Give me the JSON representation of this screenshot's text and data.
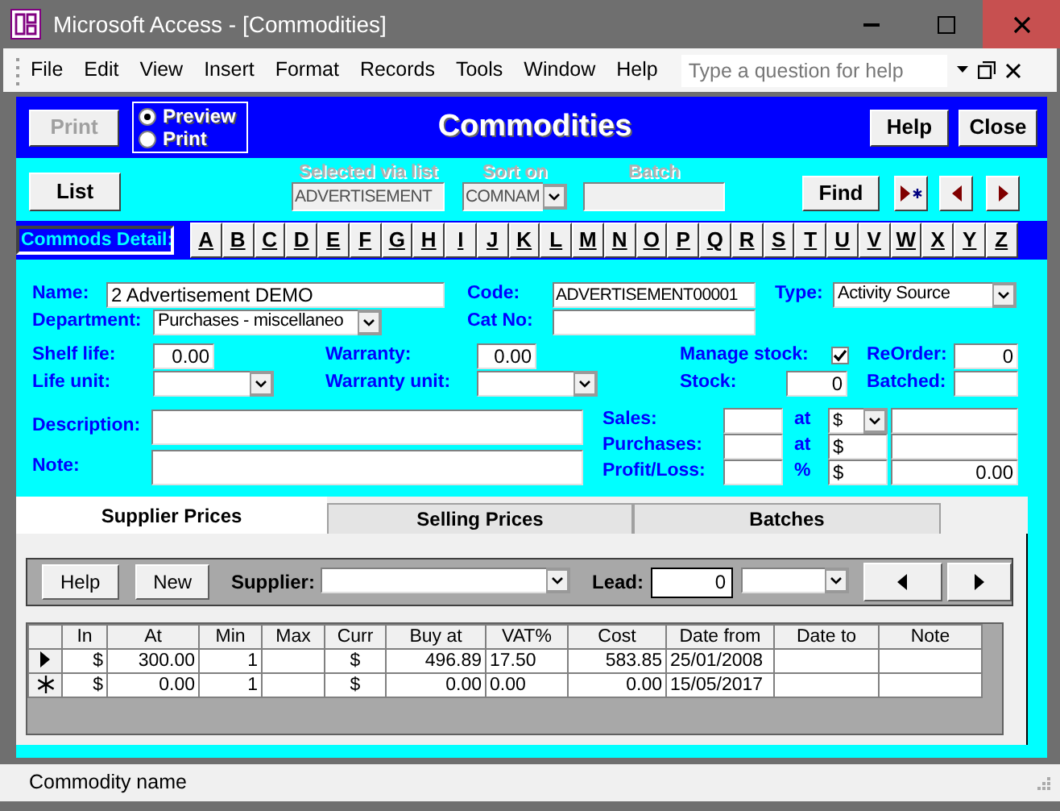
{
  "window": {
    "title": "Microsoft Access - [Commodities]"
  },
  "menu": [
    {
      "label": "File"
    },
    {
      "label": "Edit"
    },
    {
      "label": "View"
    },
    {
      "label": "Insert"
    },
    {
      "label": "Format"
    },
    {
      "label": "Records"
    },
    {
      "label": "Tools"
    },
    {
      "label": "Window"
    },
    {
      "label": "Help"
    }
  ],
  "help_search": {
    "placeholder": "Type a question for help"
  },
  "header": {
    "print_button": {
      "label": "Print",
      "disabled": true
    },
    "output_options": [
      {
        "label": "Preview",
        "selected": true
      },
      {
        "label": "Print",
        "selected": false
      }
    ],
    "title": "Commodities",
    "buttons": [
      "Help",
      "Close"
    ]
  },
  "selection_bar": {
    "list_button": "List",
    "fields": [
      {
        "label": "Selected via list",
        "value": "ADVERTISEMENT",
        "kind": "text",
        "disabled": true
      },
      {
        "label": "Sort on",
        "value": "COMNAM",
        "kind": "combo",
        "disabled": true
      },
      {
        "label": "Batch",
        "kind": "text",
        "disabled": true
      }
    ],
    "find_button": "Find"
  },
  "alphabet": {
    "label": "Commods Detail:",
    "letters": [
      "A",
      "B",
      "C",
      "D",
      "E",
      "F",
      "G",
      "H",
      "I",
      "J",
      "K",
      "L",
      "M",
      "N",
      "O",
      "P",
      "Q",
      "R",
      "S",
      "T",
      "U",
      "V",
      "W",
      "X",
      "Y",
      "Z"
    ]
  },
  "details": {
    "name": {
      "label": "Name:",
      "value": "2 Advertisement DEMO"
    },
    "code": {
      "label": "Code:",
      "value": "ADVERTISEMENT00001"
    },
    "type": {
      "label": "Type:",
      "value": "Activity Source"
    },
    "department": {
      "label": "Department:",
      "value": "Purchases - miscellaneo"
    },
    "cat_no": {
      "label": "Cat No:"
    },
    "shelf_life": {
      "label": "Shelf life:",
      "value": "0.00"
    },
    "warranty": {
      "label": "Warranty:",
      "value": "0.00"
    },
    "manage_stock": {
      "label": "Manage stock:",
      "checked": true
    },
    "reorder": {
      "label": "ReOrder:",
      "value": "0"
    },
    "life_unit": {
      "label": "Life unit:"
    },
    "warranty_unit": {
      "label": "Warranty unit:"
    },
    "stock": {
      "label": "Stock:",
      "value": "0"
    },
    "batched": {
      "label": "Batched:"
    },
    "description": {
      "label": "Description:"
    },
    "note": {
      "label": "Note:"
    },
    "sales": {
      "label": "Sales:",
      "symbol": "at",
      "currency": "$"
    },
    "purchases": {
      "label": "Purchases:",
      "symbol": "at",
      "currency": "$"
    },
    "profit_loss": {
      "label": "Profit/Loss:",
      "symbol": "%",
      "currency": "$",
      "value": "0.00"
    }
  },
  "tabs": [
    {
      "label": "Supplier Prices",
      "selected": true
    },
    {
      "label": "Selling Prices",
      "selected": false
    },
    {
      "label": "Batches",
      "selected": false
    }
  ],
  "supplier_toolbar": {
    "buttons": [
      "Help",
      "New"
    ],
    "supplier_label": "Supplier:",
    "lead_label": "Lead:",
    "lead_value": "0"
  },
  "grid": {
    "columns": [
      "In",
      "At",
      "Min",
      "Max",
      "Curr",
      "Buy at",
      "VAT%",
      "Cost",
      "Date from",
      "Date to",
      "Note"
    ],
    "rows": [
      {
        "kind": "current",
        "cells": [
          "$",
          "300.00",
          "1",
          null,
          "$",
          "496.89",
          "17.50",
          "583.85",
          "25/01/2008",
          null,
          null
        ]
      },
      {
        "kind": "new",
        "cells": [
          "$",
          "0.00",
          "1",
          null,
          "$",
          "0.00",
          "0.00",
          "0.00",
          "15/05/2017",
          null,
          null
        ]
      }
    ]
  },
  "status_bar": {
    "text": "Commodity name"
  }
}
